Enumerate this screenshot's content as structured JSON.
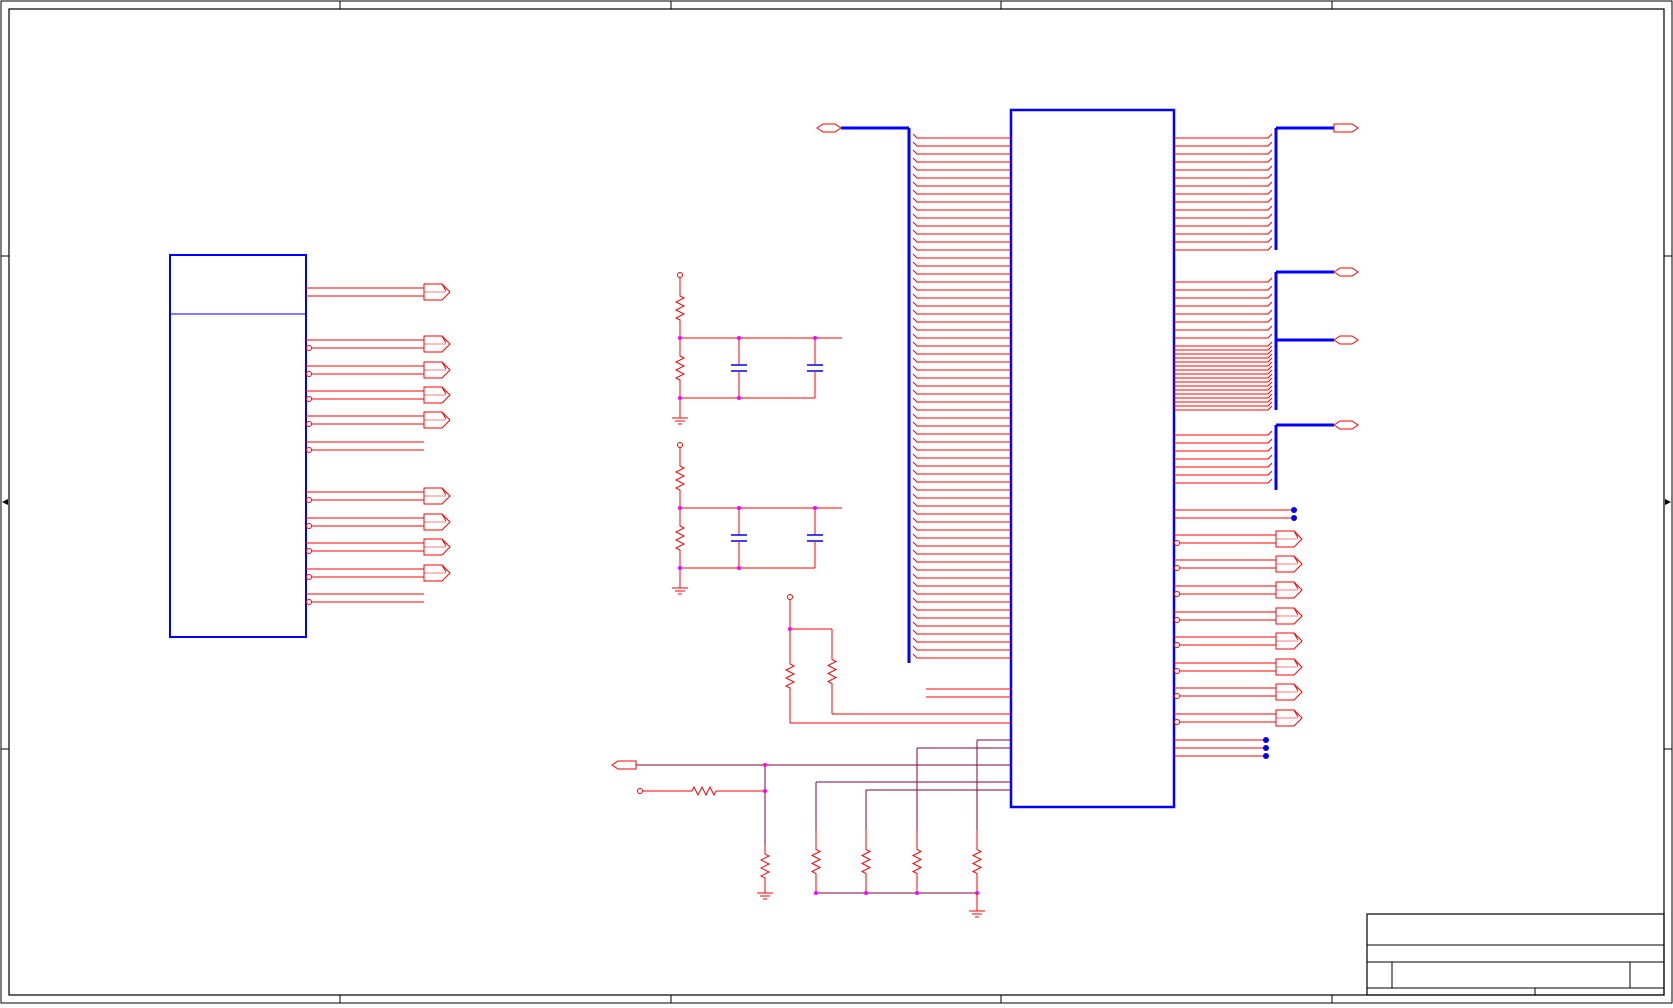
{
  "sheet": {
    "title_block": {
      "title": "",
      "document_number": "",
      "revision": "",
      "size": "",
      "sheet_info": ""
    }
  },
  "colors": {
    "wire": "#ff0000",
    "bus": "#0000ff",
    "component_outline": "#0000ff",
    "border": "#000000",
    "net_line": "#800040",
    "junction": "#ff00ff",
    "background": "#ffffff"
  },
  "icons": {
    "resistor": "zigzag-resistor-icon",
    "capacitor": "capacitor-icon",
    "ground": "ground-icon",
    "power_port": "power-port-icon",
    "net_port": "net-port-icon",
    "no_connect": "junction-dot-icon"
  }
}
